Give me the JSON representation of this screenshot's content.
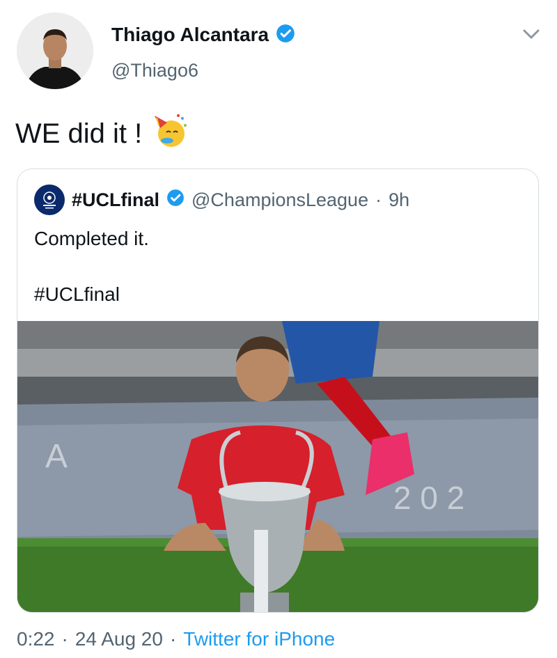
{
  "author": {
    "name": "Thiago Alcantara",
    "handle": "@Thiago6",
    "verified": true,
    "avatar_icon": "avatar"
  },
  "tweet": {
    "text": "WE did it !",
    "emoji_icon": "partying-face-emoji-icon"
  },
  "quote": {
    "name": "#UCLfinal",
    "verified": true,
    "handle": "@ChampionsLeague",
    "separator": "·",
    "time": "9h",
    "line1": "Completed it.",
    "line2": "#UCLfinal",
    "logo_icon": "champions-league-logo-icon",
    "media": "player-with-trophy-photo"
  },
  "footer": {
    "time": "0:22",
    "sep1": "·",
    "date": "24 Aug 20",
    "sep2": "·",
    "source": "Twitter for iPhone"
  },
  "colors": {
    "verified": "#1d9bf0",
    "secondary_text": "#536471",
    "link": "#1d9bf0",
    "border": "#d7dde1"
  }
}
